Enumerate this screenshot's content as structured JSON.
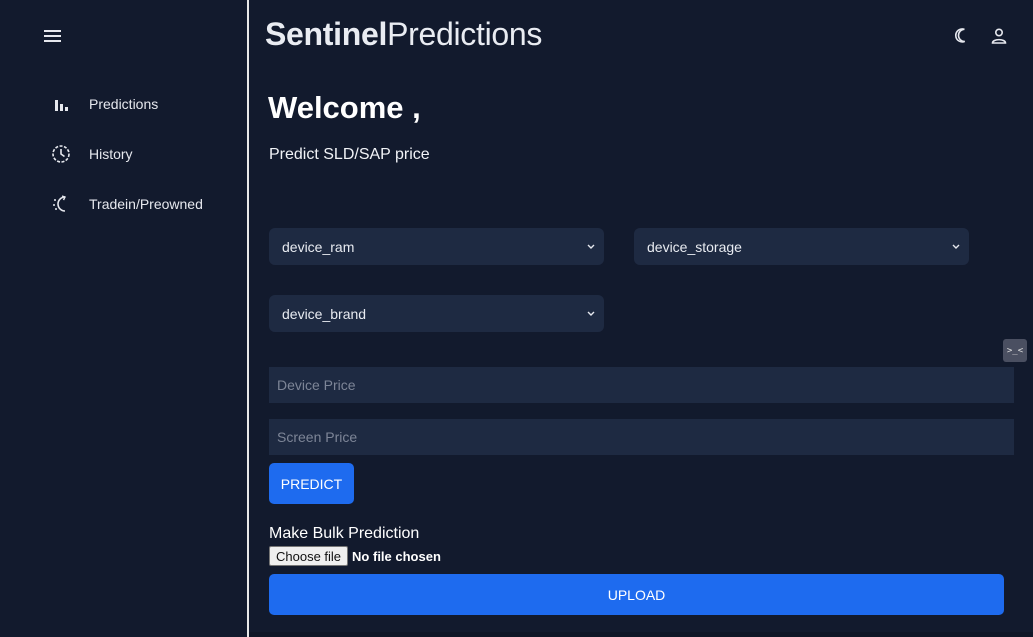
{
  "app": {
    "brand_bold": "Sentinel",
    "brand_light": "Predictions"
  },
  "sidebar": {
    "items": [
      {
        "label": "Predictions",
        "icon": "bar-chart-icon"
      },
      {
        "label": "History",
        "icon": "clock-icon"
      },
      {
        "label": "Tradein/Preowned",
        "icon": "swap-icon"
      }
    ]
  },
  "header": {
    "icons": [
      "moon-icon",
      "user-icon"
    ]
  },
  "main": {
    "welcome": "Welcome ,",
    "subtitle": "Predict SLD/SAP price",
    "selects": {
      "ram": "device_ram",
      "storage": "device_storage",
      "brand": "device_brand"
    },
    "inputs": {
      "device_price_placeholder": "Device Price",
      "screen_price_placeholder": "Screen Price"
    },
    "predict_label": "PREDICT",
    "bulk_title": "Make Bulk Prediction",
    "choose_file_label": "Choose file",
    "no_file_label": "No file chosen",
    "upload_label": "UPLOAD"
  },
  "colors": {
    "background": "#121a2d",
    "field": "#1e2a42",
    "accent": "#1e6bef"
  }
}
